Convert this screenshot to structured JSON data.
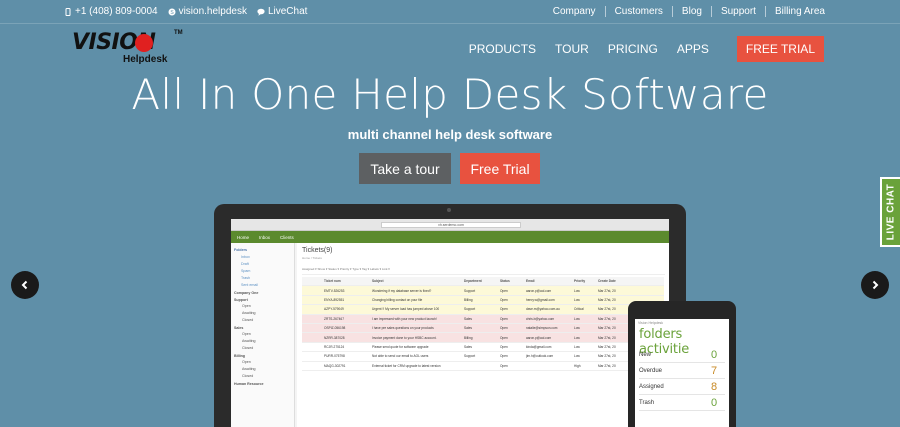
{
  "topbar": {
    "phone": "+1 (408) 809-0004",
    "skype": "vision.helpdesk",
    "livechat": "LiveChat",
    "links": [
      "Company",
      "Customers",
      "Blog",
      "Support",
      "Billing Area"
    ]
  },
  "brand": {
    "word": "VISION",
    "tm": "TM",
    "sub": "Helpdesk"
  },
  "nav": {
    "items": [
      "PRODUCTS",
      "TOUR",
      "PRICING",
      "APPS"
    ],
    "cta": "FREE TRIAL"
  },
  "hero": {
    "headline": "All In One Help Desk Software",
    "subhead": "multi channel help desk software",
    "tour_button": "Take a tour",
    "trial_button": "Free Trial"
  },
  "carousel": {
    "prev": "‹",
    "next": "›"
  },
  "live_chat_tab": "LIVE CHAT",
  "screen": {
    "url": "vh.serdemo.com",
    "nav": [
      "Home",
      "Inbox",
      "Clients"
    ],
    "title": "Tickets(9)",
    "crumb": "Home / Tickets",
    "toolbar": "Assigned ▾   Show ▾   Status ▾   Priority ▾   Type ▾   Tag ▾   Labels ▾   Link ▾",
    "sidebar": {
      "group": "Folders",
      "folders": [
        "Inbox",
        "Draft",
        "Spam",
        "Trash",
        "Sent email"
      ],
      "sections": [
        {
          "name": "Company One",
          "subs": []
        },
        {
          "name": "Support",
          "subs": [
            "Open",
            "Awaiting",
            "Closed"
          ]
        },
        {
          "name": "Sales",
          "subs": [
            "Open",
            "Awaiting",
            "Closed"
          ]
        },
        {
          "name": "Billing",
          "subs": [
            "Open",
            "Awaiting",
            "Closed"
          ]
        },
        {
          "name": "Human Resource",
          "subs": []
        }
      ]
    },
    "columns": [
      "",
      "Ticket num",
      "Subject",
      "Department",
      "Status",
      "Email",
      "Priority",
      "Create Date"
    ],
    "rows": [
      {
        "t": "y",
        "cells": [
          "",
          "EMTV-526253",
          "Wondering if my database server is fixed?",
          "Support",
          "Open",
          "aaron.p@aol.com",
          "Low",
          "Mar 27st, 20"
        ]
      },
      {
        "t": "y",
        "cells": [
          "",
          "ENYA-892551",
          "Changing billing contact on your file",
          "Billing",
          "Open",
          "henry.w@gmail.com",
          "Low",
          "Mar 27st, 20"
        ]
      },
      {
        "t": "y",
        "cells": [
          "",
          "AZPY-579049",
          "Urgent !! My server load has jumped above 100",
          "Support",
          "Open",
          "dave.m@yahoo.com.au",
          "Critical",
          "Mar 27st, 20"
        ]
      },
      {
        "t": "p",
        "cells": [
          "",
          "ZRTS-267467",
          "I am impressed with your new product launch!",
          "Sales",
          "Open",
          "chris.b@yahoo.com",
          "Low",
          "Mar 27st, 20"
        ]
      },
      {
        "t": "p",
        "cells": [
          "",
          "OSPIZ-056198",
          "I have pre sales questions on your products",
          "Sales",
          "Open",
          "natalie@simpson.com",
          "Low",
          "Mar 27st, 20"
        ]
      },
      {
        "t": "p",
        "cells": [
          "",
          "NZRR-387028",
          "Invoice payment done to your HSBC account.",
          "Billing",
          "Open",
          "aaron.p@aol.com",
          "Low",
          "Mar 27st, 20"
        ]
      },
      {
        "t": "",
        "cells": [
          "",
          "RCJR-275124",
          "Please send quote for software upgrade",
          "Sales",
          "Open",
          "kinda@gmail.com",
          "Low",
          "Mar 27st, 20"
        ]
      },
      {
        "t": "",
        "cells": [
          "",
          "PURR-075798",
          "Not able to send our email to AOL users",
          "Support",
          "Open",
          "jim.h@outlook.com",
          "Low",
          "Mar 27st, 20"
        ]
      },
      {
        "t": "",
        "cells": [
          "",
          "MAQG-302791",
          "External ticket for CRM upgrade to latest version",
          "",
          "Open",
          "",
          "High",
          "Mar 27st, 20"
        ]
      }
    ]
  },
  "phone": {
    "app": "Vision Helpdesk",
    "title": "folders activitie",
    "rows": [
      {
        "label": "New",
        "count": "0"
      },
      {
        "label": "Overdue",
        "count": "7"
      },
      {
        "label": "Assigned",
        "count": "8"
      },
      {
        "label": "Trash",
        "count": "0"
      }
    ]
  }
}
